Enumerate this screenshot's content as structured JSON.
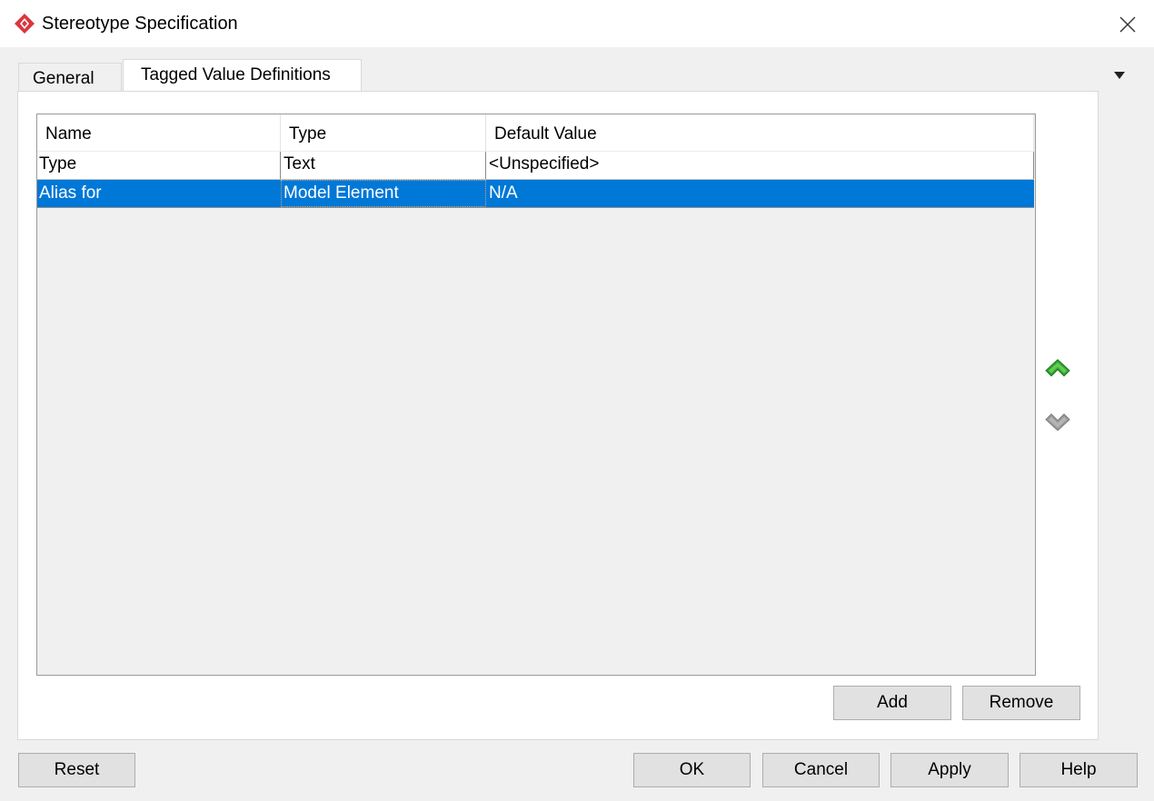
{
  "window": {
    "title": "Stereotype Specification",
    "icon": "app-diamond-icon",
    "close_icon": "close-icon"
  },
  "tabs": [
    {
      "label": "General",
      "selected": false
    },
    {
      "label": "Tagged Value Definitions",
      "selected": true
    }
  ],
  "tab_menu_icon": "chevron-down-icon",
  "table": {
    "columns": [
      "Name",
      "Type",
      "Default Value"
    ],
    "rows": [
      {
        "name": "Type",
        "type": "Text",
        "default": "<Unspecified>",
        "selected": false
      },
      {
        "name": "Alias for",
        "type": "Model Element",
        "default": "N/A",
        "selected": true
      }
    ]
  },
  "reorder": {
    "up_icon": "move-up-icon",
    "up_color": "#2fa12f",
    "down_icon": "move-down-icon",
    "down_color": "#9a9a9a"
  },
  "panel_buttons": {
    "add": "Add",
    "remove": "Remove"
  },
  "footer_buttons": {
    "reset": "Reset",
    "ok": "OK",
    "cancel": "Cancel",
    "apply": "Apply",
    "help": "Help"
  },
  "colors": {
    "selection": "#0078d7",
    "brand": "#d9363e"
  }
}
